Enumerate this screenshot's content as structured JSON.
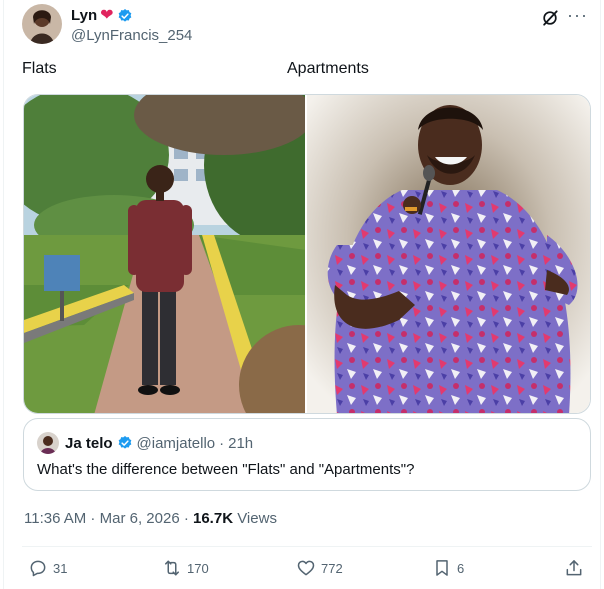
{
  "author": {
    "name": "Lyn",
    "name_emoji": "heart",
    "verified": true,
    "handle": "@LynFrancis_254"
  },
  "tweet": {
    "text_left": "Flats",
    "text_right": "Apartments"
  },
  "media": [
    {
      "icon": "photo-slim-man-garden"
    },
    {
      "icon": "photo-large-man-microphone"
    }
  ],
  "quoted": {
    "name": "Ja telo",
    "verified": true,
    "handle": "@iamjatello",
    "sep": " · ",
    "time": "21h",
    "text": "What's the difference between \"Flats\" and \"Apartments\"?"
  },
  "meta": {
    "time": "11:36 AM",
    "date": "Mar 6, 2026",
    "sep": " · ",
    "views_count": "16.7K",
    "views_label": " Views"
  },
  "actions": {
    "replies": "31",
    "reposts": "170",
    "likes": "772",
    "bookmarks": "6"
  },
  "colors": {
    "verified": "#1d9bf0",
    "heart": "#e0245e",
    "text_secondary": "#536471",
    "border": "#cfd9de"
  }
}
